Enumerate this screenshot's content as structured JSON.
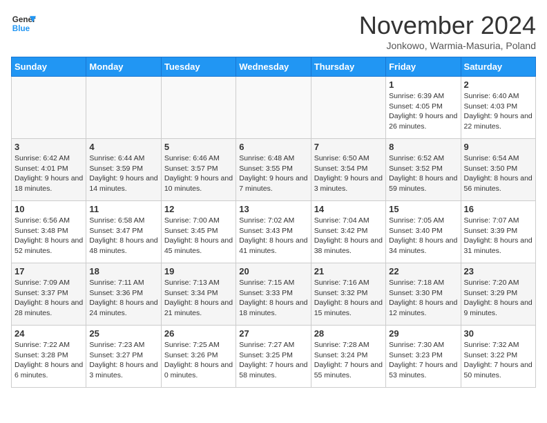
{
  "header": {
    "logo_line1": "General",
    "logo_line2": "Blue",
    "month_title": "November 2024",
    "location": "Jonkowo, Warmia-Masuria, Poland"
  },
  "days_of_week": [
    "Sunday",
    "Monday",
    "Tuesday",
    "Wednesday",
    "Thursday",
    "Friday",
    "Saturday"
  ],
  "weeks": [
    [
      {
        "day": "",
        "info": ""
      },
      {
        "day": "",
        "info": ""
      },
      {
        "day": "",
        "info": ""
      },
      {
        "day": "",
        "info": ""
      },
      {
        "day": "",
        "info": ""
      },
      {
        "day": "1",
        "info": "Sunrise: 6:39 AM\nSunset: 4:05 PM\nDaylight: 9 hours and 26 minutes."
      },
      {
        "day": "2",
        "info": "Sunrise: 6:40 AM\nSunset: 4:03 PM\nDaylight: 9 hours and 22 minutes."
      }
    ],
    [
      {
        "day": "3",
        "info": "Sunrise: 6:42 AM\nSunset: 4:01 PM\nDaylight: 9 hours and 18 minutes."
      },
      {
        "day": "4",
        "info": "Sunrise: 6:44 AM\nSunset: 3:59 PM\nDaylight: 9 hours and 14 minutes."
      },
      {
        "day": "5",
        "info": "Sunrise: 6:46 AM\nSunset: 3:57 PM\nDaylight: 9 hours and 10 minutes."
      },
      {
        "day": "6",
        "info": "Sunrise: 6:48 AM\nSunset: 3:55 PM\nDaylight: 9 hours and 7 minutes."
      },
      {
        "day": "7",
        "info": "Sunrise: 6:50 AM\nSunset: 3:54 PM\nDaylight: 9 hours and 3 minutes."
      },
      {
        "day": "8",
        "info": "Sunrise: 6:52 AM\nSunset: 3:52 PM\nDaylight: 8 hours and 59 minutes."
      },
      {
        "day": "9",
        "info": "Sunrise: 6:54 AM\nSunset: 3:50 PM\nDaylight: 8 hours and 56 minutes."
      }
    ],
    [
      {
        "day": "10",
        "info": "Sunrise: 6:56 AM\nSunset: 3:48 PM\nDaylight: 8 hours and 52 minutes."
      },
      {
        "day": "11",
        "info": "Sunrise: 6:58 AM\nSunset: 3:47 PM\nDaylight: 8 hours and 48 minutes."
      },
      {
        "day": "12",
        "info": "Sunrise: 7:00 AM\nSunset: 3:45 PM\nDaylight: 8 hours and 45 minutes."
      },
      {
        "day": "13",
        "info": "Sunrise: 7:02 AM\nSunset: 3:43 PM\nDaylight: 8 hours and 41 minutes."
      },
      {
        "day": "14",
        "info": "Sunrise: 7:04 AM\nSunset: 3:42 PM\nDaylight: 8 hours and 38 minutes."
      },
      {
        "day": "15",
        "info": "Sunrise: 7:05 AM\nSunset: 3:40 PM\nDaylight: 8 hours and 34 minutes."
      },
      {
        "day": "16",
        "info": "Sunrise: 7:07 AM\nSunset: 3:39 PM\nDaylight: 8 hours and 31 minutes."
      }
    ],
    [
      {
        "day": "17",
        "info": "Sunrise: 7:09 AM\nSunset: 3:37 PM\nDaylight: 8 hours and 28 minutes."
      },
      {
        "day": "18",
        "info": "Sunrise: 7:11 AM\nSunset: 3:36 PM\nDaylight: 8 hours and 24 minutes."
      },
      {
        "day": "19",
        "info": "Sunrise: 7:13 AM\nSunset: 3:34 PM\nDaylight: 8 hours and 21 minutes."
      },
      {
        "day": "20",
        "info": "Sunrise: 7:15 AM\nSunset: 3:33 PM\nDaylight: 8 hours and 18 minutes."
      },
      {
        "day": "21",
        "info": "Sunrise: 7:16 AM\nSunset: 3:32 PM\nDaylight: 8 hours and 15 minutes."
      },
      {
        "day": "22",
        "info": "Sunrise: 7:18 AM\nSunset: 3:30 PM\nDaylight: 8 hours and 12 minutes."
      },
      {
        "day": "23",
        "info": "Sunrise: 7:20 AM\nSunset: 3:29 PM\nDaylight: 8 hours and 9 minutes."
      }
    ],
    [
      {
        "day": "24",
        "info": "Sunrise: 7:22 AM\nSunset: 3:28 PM\nDaylight: 8 hours and 6 minutes."
      },
      {
        "day": "25",
        "info": "Sunrise: 7:23 AM\nSunset: 3:27 PM\nDaylight: 8 hours and 3 minutes."
      },
      {
        "day": "26",
        "info": "Sunrise: 7:25 AM\nSunset: 3:26 PM\nDaylight: 8 hours and 0 minutes."
      },
      {
        "day": "27",
        "info": "Sunrise: 7:27 AM\nSunset: 3:25 PM\nDaylight: 7 hours and 58 minutes."
      },
      {
        "day": "28",
        "info": "Sunrise: 7:28 AM\nSunset: 3:24 PM\nDaylight: 7 hours and 55 minutes."
      },
      {
        "day": "29",
        "info": "Sunrise: 7:30 AM\nSunset: 3:23 PM\nDaylight: 7 hours and 53 minutes."
      },
      {
        "day": "30",
        "info": "Sunrise: 7:32 AM\nSunset: 3:22 PM\nDaylight: 7 hours and 50 minutes."
      }
    ]
  ]
}
